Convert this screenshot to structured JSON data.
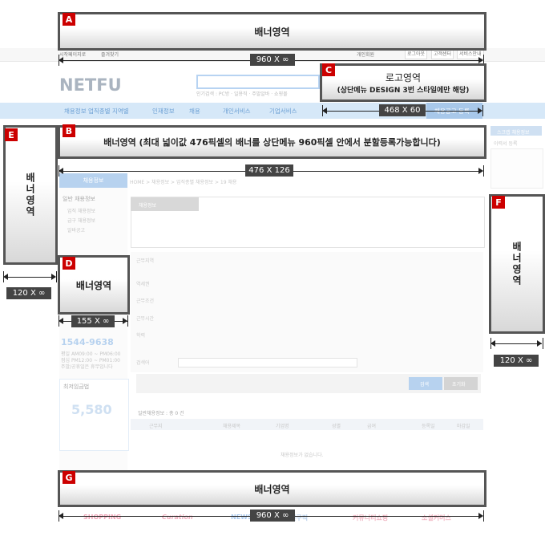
{
  "banners": {
    "A": {
      "label": "A",
      "text": "배너영역"
    },
    "B": {
      "label": "B",
      "text": "배너영역 (최대 넓이값 476픽셀의 배너를 상단메뉴 960픽셀 안에서 분할등록가능합니다)"
    },
    "C": {
      "label": "C",
      "title": "로고영역",
      "subtitle": "(상단메뉴 DESIGN 3번 스타일에만 해당)"
    },
    "D": {
      "label": "D",
      "text": "배너영역"
    },
    "E": {
      "label": "E",
      "text": "배너영역"
    },
    "F": {
      "label": "F",
      "text": "배너영역"
    },
    "G": {
      "label": "G",
      "text": "배너영역"
    }
  },
  "dimensions": {
    "top_width": "960 X ∞",
    "logo_size": "468 X 60",
    "b_width": "476 X 126",
    "e_width": "120 X ∞",
    "d_width": "155 X ∞",
    "f_width": "120 X ∞",
    "g_width": "960 X ∞"
  },
  "topbar": {
    "left_links": [
      "시작페이지로",
      "즐겨찾기"
    ],
    "right_links": [
      "개인회원",
      "로그아웃",
      "고객센터",
      "서비스안내"
    ]
  },
  "header": {
    "logo": "NETFU",
    "search_links": "인기검색 : PC방 · 일용직 · 주말알바 · 쇼핑몰"
  },
  "nav": {
    "items": [
      "채용정보  업직종별  지역별",
      "인재정보",
      "채용",
      "개인서비스",
      "기업서비스"
    ],
    "active": "채용공고 등록"
  },
  "left": {
    "head": "채용정보",
    "sub": "일반 채용정보",
    "items": [
      "업직 채용정보",
      "급구 채용정보",
      "알바공고"
    ],
    "phone": "1544-9638",
    "hours": [
      "평일 AM09:00 ~ PM06:00",
      "점심 PM12:00 ~ PM01:00",
      "주말/공휴일은 휴무입니다"
    ],
    "wage_title": "최저임금법",
    "wage_value": "5,580"
  },
  "main": {
    "breadcrumb": "HOME > 채용정보 > 업직종별 채용정보 > 19 채용",
    "tab": "채용정보",
    "rows": [
      "근무지역",
      "역세권",
      "근무조건",
      "근무시간",
      "학력",
      "검색어"
    ],
    "list_title": "일반채용정보 : 총 0 건",
    "columns": [
      "근무지",
      "채용제목",
      "기업명",
      "성별",
      "급여",
      "등록일",
      "마감일"
    ],
    "empty": "채용정보가 없습니다.",
    "search_btn": "검색",
    "reset_btn": "초기화"
  },
  "right_side": {
    "items": [
      "스크랩 채용정보",
      "이력서 등록"
    ]
  },
  "footer": {
    "logos": [
      "SHOPPING",
      "Curation",
      "NEWS",
      "인구직",
      "커뮤니티쇼핑",
      "소셜커머스"
    ]
  }
}
